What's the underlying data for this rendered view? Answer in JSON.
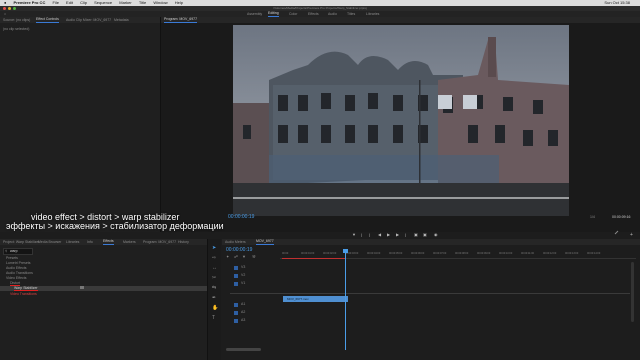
{
  "menubar": {
    "app": "Premiere Pro CC",
    "items": [
      "File",
      "Edit",
      "Clip",
      "Sequence",
      "Marker",
      "Title",
      "Window",
      "Help"
    ],
    "clock": "Sun Oct 15:38"
  },
  "titlebar": {
    "text": "/Volumes/Media/Projects/Premiere Pro Projects/Warp_Stabilizer.prproj"
  },
  "workspaces": {
    "items": [
      "Assembly",
      "Editing",
      "Color",
      "Effects",
      "Audio",
      "Titles",
      "Libraries"
    ],
    "active": "Editing"
  },
  "source_panel": {
    "tabs": [
      "Source: (no clips)",
      "Effect Controls",
      "Audio Clip Mixer: MOV_6977",
      "Metadata"
    ],
    "active_tab": "Effect Controls",
    "message": "(no clip selected)"
  },
  "program_panel": {
    "tabs": [
      "Program: MOV_6977"
    ],
    "timecode_left": "00:00:00:19",
    "fit_label": "Fit",
    "quarter_label": "1/4",
    "timecode_right": "00:00:09:16",
    "transport_icons": [
      "mark-in-icon",
      "mark-out-icon",
      "go-to-in-icon",
      "step-back-icon",
      "play-icon",
      "step-forward-icon",
      "go-to-out-icon",
      "insert-icon",
      "overwrite-icon",
      "export-frame-icon"
    ]
  },
  "subtitles": {
    "line1": "video effect > distort > warp stabilizer",
    "line2": "эффекты > искажения > стабилизатор деформации"
  },
  "project_panel": {
    "tabs": [
      "Project: Warp Stabilizer",
      "Media Browser",
      "Libraries",
      "Info",
      "Effects",
      "Markers",
      "Program: MOV_6977",
      "History"
    ],
    "active_tab": "Effects",
    "search_value": "warp",
    "tree": [
      {
        "label": "Presets",
        "indent": 0
      },
      {
        "label": "Lumetri Presets",
        "indent": 0
      },
      {
        "label": "Audio Effects",
        "indent": 0
      },
      {
        "label": "Audio Transitions",
        "indent": 0
      },
      {
        "label": "Video Effects",
        "indent": 0
      },
      {
        "label": "Distort",
        "indent": 1
      },
      {
        "label": "Warp Stabilizer",
        "indent": 2
      },
      {
        "label": "Video Transitions",
        "indent": 0
      }
    ],
    "highlight_color": "#e02020"
  },
  "tools": [
    "selection-icon",
    "track-select-icon",
    "ripple-edit-icon",
    "razor-icon",
    "slip-icon",
    "pen-icon",
    "hand-icon",
    "type-icon"
  ],
  "timeline": {
    "tabs": [
      "Audio Meters",
      "MOV_6977"
    ],
    "active_tab": "MOV_6977",
    "timecode": "00:00:00:19",
    "ruler": [
      "00:00",
      "00:00:01:00",
      "00:00:02:00",
      "00:00:03:00",
      "00:00:04:00",
      "00:00:05:00",
      "00:00:06:00",
      "00:00:07:00",
      "00:00:08:00",
      "00:00:09:00",
      "00:00:10:00",
      "00:00:11:00",
      "00:00:12:00",
      "00:00:13:00",
      "00:00:14:00"
    ],
    "video_tracks": [
      "V3",
      "V2",
      "V1"
    ],
    "audio_tracks": [
      "A1",
      "A2",
      "A3"
    ],
    "clip_label": "MOV_6977.mov",
    "clip_color": "#4f8fd1",
    "playhead_color": "#4a9de8"
  }
}
